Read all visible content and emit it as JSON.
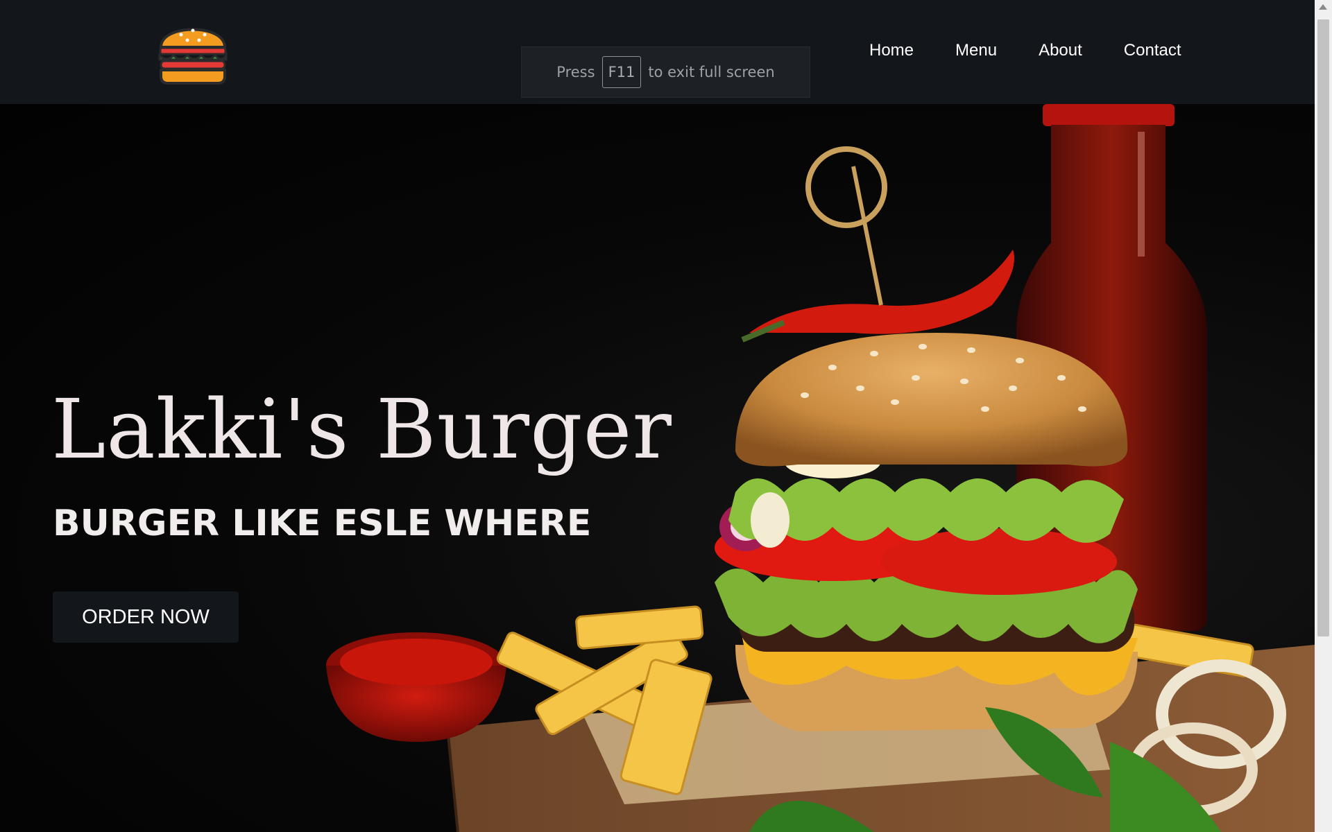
{
  "header": {
    "logo_icon": "burger-icon",
    "nav": [
      {
        "label": "Home"
      },
      {
        "label": "Menu"
      },
      {
        "label": "About"
      },
      {
        "label": "Contact"
      }
    ]
  },
  "fullscreen_notice": {
    "press": "Press",
    "key": "F11",
    "rest": "to exit full screen"
  },
  "hero": {
    "title": "Lakki's Burger",
    "subtitle": "BURGER LIKE ESLE WHERE",
    "cta": "ORDER NOW",
    "image_subject": "burger-with-fries-ketchup-bottle"
  },
  "colors": {
    "header_bg": "#13161a",
    "hero_bg": "#070707",
    "button_bg": "#13171b",
    "text_light": "#efe7e7"
  }
}
